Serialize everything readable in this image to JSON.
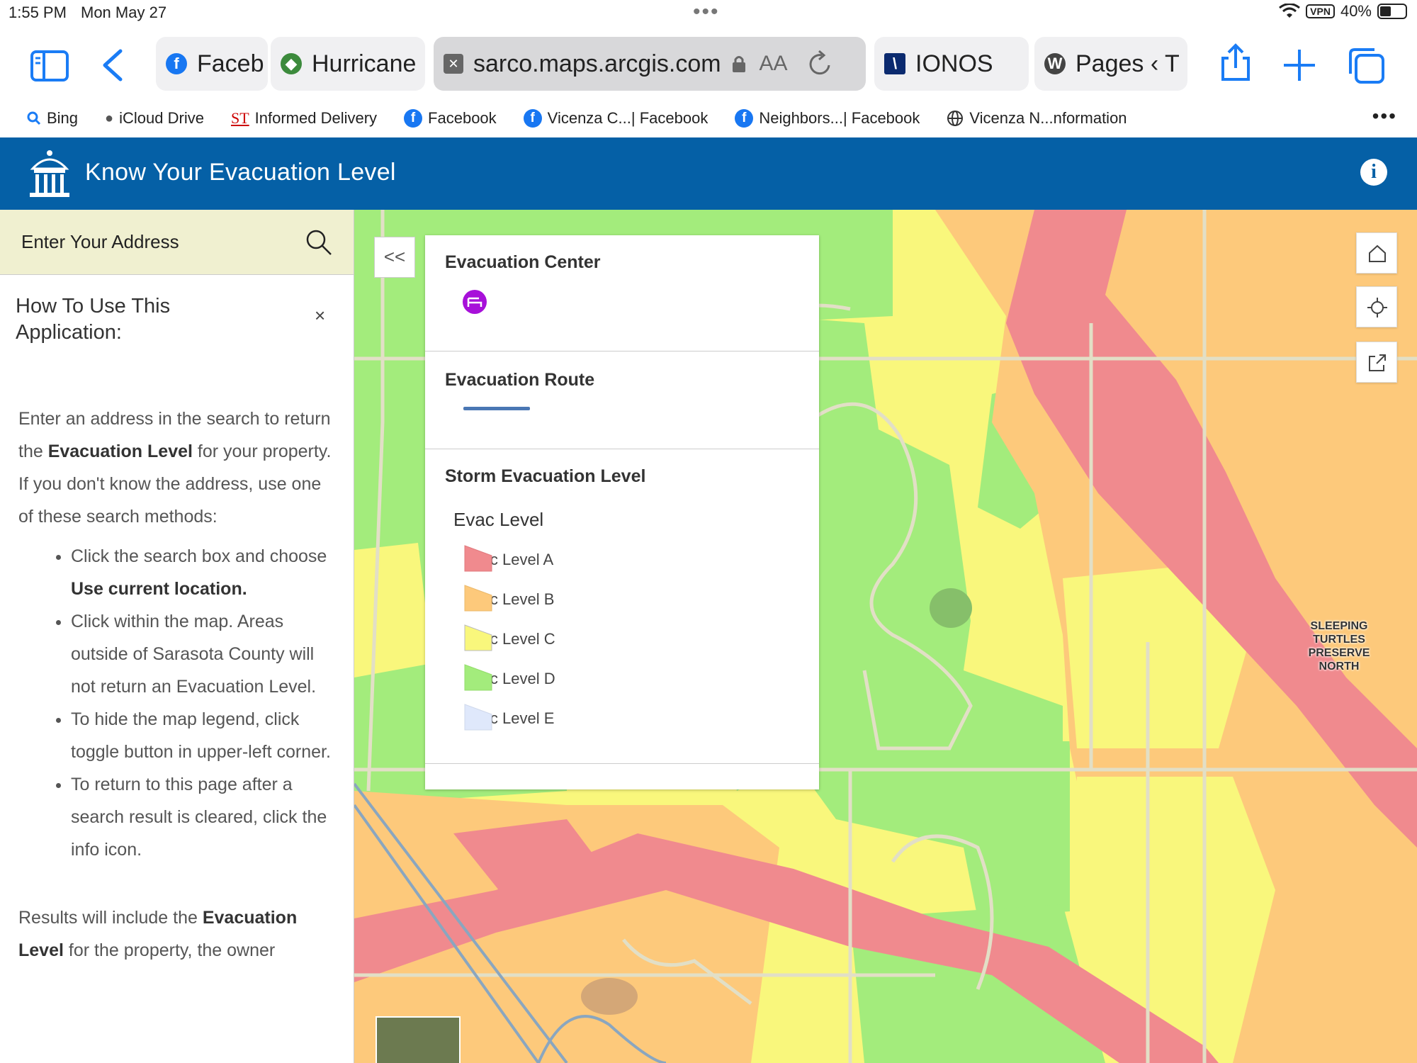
{
  "status_bar": {
    "time": "1:55 PM",
    "date": "Mon May 27",
    "vpn": "VPN",
    "battery": "40%"
  },
  "toolbar": {
    "tabs": [
      {
        "label": "Faceb",
        "icon": "facebook-icon"
      },
      {
        "label": "Hurricane",
        "icon": "county-seal-icon"
      },
      {
        "label": "sarco.maps.arcgis.com",
        "icon": "close-tab-icon",
        "text_size": "AA",
        "active": true
      },
      {
        "label": "IONOS",
        "icon": "ionos-icon"
      },
      {
        "label": "Pages ‹ T",
        "icon": "wordpress-icon"
      }
    ]
  },
  "favorites": [
    {
      "label": "Bing",
      "icon": "search-icon"
    },
    {
      "label": "iCloud Drive",
      "icon": "apple-icon"
    },
    {
      "label": "Informed Delivery",
      "icon": "usps-icon"
    },
    {
      "label": "Facebook",
      "icon": "facebook-icon"
    },
    {
      "label": "Vicenza C...| Facebook",
      "icon": "facebook-icon"
    },
    {
      "label": "Neighbors...| Facebook",
      "icon": "facebook-icon"
    },
    {
      "label": "Vicenza N...nformation",
      "icon": "globe-icon"
    }
  ],
  "app": {
    "title": "Know Your Evacuation Level"
  },
  "sidebar": {
    "search_placeholder": "Enter Your Address",
    "how_title": "How To Use This Application:",
    "close": "×",
    "p1_a": "Enter an address in the search to return the ",
    "p1_b": "Evacuation Level",
    "p1_c": " for your property.",
    "p2": "If you don't know the address, use one of these search methods:",
    "li1_a": "Click the search box and choose ",
    "li1_b": "Use current location.",
    "li2": "Click within the map. Areas outside of Sarasota County will not return an Evacuation Level.",
    "li3": "To hide the map legend, click toggle button in upper-left corner.",
    "li4": "To return to this page after a search result is cleared, click the info icon.",
    "p3_a": "Results will include the ",
    "p3_b": "Evacuation Level",
    "p3_c": " for the property, the owner"
  },
  "map": {
    "collapse": "<<",
    "label": "SLEEPING TURTLES PRESERVE NORTH",
    "colors": {
      "level_a": "#f08a8e",
      "level_b": "#fdc97b",
      "level_c": "#f9f77c",
      "level_d": "#a3ec7c",
      "level_e": "#dfe8fb",
      "route": "#4a77b4",
      "center": "#a710d9"
    }
  },
  "legend": {
    "center_title": "Evacuation Center",
    "route_title": "Evacuation Route",
    "storm_title": "Storm Evacuation Level",
    "evac_label": "Evac Level",
    "levels": [
      {
        "label": "Evac Level A",
        "color": "#f08a8e"
      },
      {
        "label": "Evac Level B",
        "color": "#fdc97b"
      },
      {
        "label": "Evac Level C",
        "color": "#f9f77c"
      },
      {
        "label": "Evac Level D",
        "color": "#a3ec7c"
      },
      {
        "label": "Evac Level E",
        "color": "#dfe8fb"
      }
    ]
  }
}
